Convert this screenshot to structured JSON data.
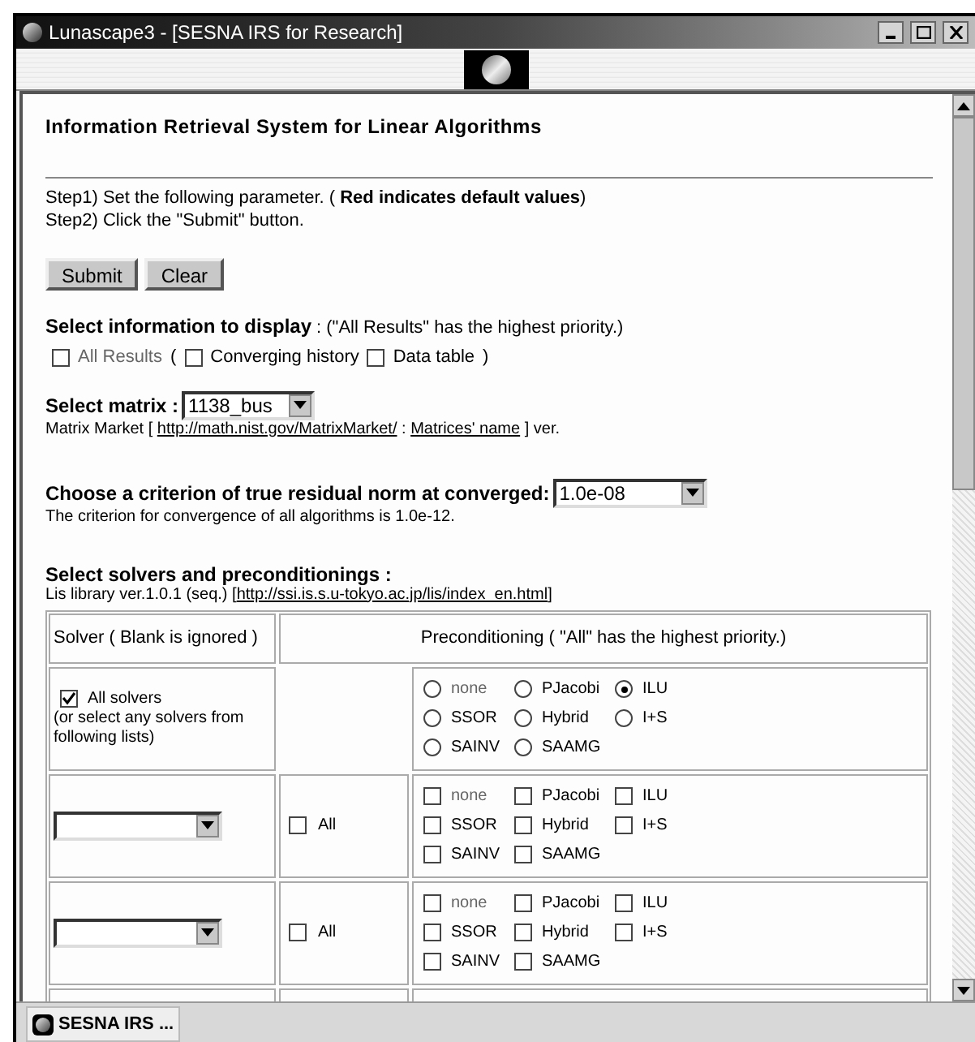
{
  "window": {
    "title": "Lunascape3 - [SESNA IRS for Research]"
  },
  "page": {
    "heading": "Information Retrieval System for Linear Algorithms",
    "steps": [
      "Step1) Set the following parameter. ( **Red indicates default values**)",
      "Step2) Click the \"Submit\" button."
    ],
    "buttons": [
      "Submit",
      "Clear"
    ],
    "display": {
      "label": "Select information to display",
      "note": ": (\"All Results\" has the highest priority.)",
      "items": [
        {
          "kind": "checkbox",
          "label": "All Results",
          "checked": false,
          "default": true
        },
        {
          "kind": "text",
          "label": "("
        },
        {
          "kind": "checkbox",
          "label": "Converging history",
          "checked": false,
          "default": false
        },
        {
          "kind": "checkbox",
          "label": "Data table",
          "checked": false,
          "default": false
        },
        {
          "kind": "text",
          "label": ")"
        }
      ]
    },
    "matrix": {
      "label": "Select matrix :",
      "value": "1138_bus",
      "source": [
        {
          "kind": "text",
          "text": "Matrix Market [ "
        },
        {
          "kind": "link",
          "text": "http://math.nist.gov/MatrixMarket/"
        },
        {
          "kind": "text",
          "text": " : "
        },
        {
          "kind": "link",
          "text": "Matrices' name"
        },
        {
          "kind": "text",
          "text": " ] ver."
        }
      ]
    },
    "criterion": {
      "label": "Choose a criterion of true residual norm at converged:",
      "value": "1.0e-08",
      "note": "The criterion for convergence of all algorithms is 1.0e-12."
    },
    "solvers": {
      "label": "Select solvers and preconditionings :",
      "library": [
        {
          "kind": "text",
          "text": "Lis library ver.1.0.1 (seq.) ["
        },
        {
          "kind": "link",
          "text": "http://ssi.is.s.u-tokyo.ac.jp/lis/index_en.html"
        },
        {
          "kind": "text",
          "text": "]"
        }
      ],
      "headers": [
        "Solver ( Blank is ignored )",
        "Preconditioning ( \"All\" has the highest priority.)"
      ],
      "rows": [
        {
          "kind": "all",
          "label": "All solvers",
          "checked": true,
          "note": "(or select any solvers from following lists)",
          "options": [
            {
              "label": "none",
              "selected": false,
              "default": true
            },
            {
              "label": "PJacobi",
              "selected": false,
              "default": false
            },
            {
              "label": "ILU",
              "selected": true,
              "default": false
            },
            {
              "label": "SSOR",
              "selected": false,
              "default": false
            },
            {
              "label": "Hybrid",
              "selected": false,
              "default": false
            },
            {
              "label": "I+S",
              "selected": false,
              "default": false
            },
            {
              "label": "SAINV",
              "selected": false,
              "default": false
            },
            {
              "label": "SAAMG",
              "selected": false,
              "default": false
            }
          ]
        },
        {
          "kind": "select",
          "all_label": "All",
          "all_checked": false,
          "options": [
            {
              "label": "none",
              "checked": false,
              "default": true
            },
            {
              "label": "PJacobi",
              "checked": false,
              "default": false
            },
            {
              "label": "ILU",
              "checked": false,
              "default": false
            },
            {
              "label": "SSOR",
              "checked": false,
              "default": false
            },
            {
              "label": "Hybrid",
              "checked": false,
              "default": false
            },
            {
              "label": "I+S",
              "checked": false,
              "default": false
            },
            {
              "label": "SAINV",
              "checked": false,
              "default": false
            },
            {
              "label": "SAAMG",
              "checked": false,
              "default": false
            }
          ]
        },
        {
          "kind": "select",
          "all_label": "All",
          "all_checked": false,
          "options": [
            {
              "label": "none",
              "checked": false,
              "default": true
            },
            {
              "label": "PJacobi",
              "checked": false,
              "default": false
            },
            {
              "label": "ILU",
              "checked": false,
              "default": false
            },
            {
              "label": "SSOR",
              "checked": false,
              "default": false
            },
            {
              "label": "Hybrid",
              "checked": false,
              "default": false
            },
            {
              "label": "I+S",
              "checked": false,
              "default": false
            },
            {
              "label": "SAINV",
              "checked": false,
              "default": false
            },
            {
              "label": "SAAMG",
              "checked": false,
              "default": false
            }
          ]
        }
      ]
    }
  },
  "taskbar": {
    "tab": "SESNA IRS ..."
  }
}
